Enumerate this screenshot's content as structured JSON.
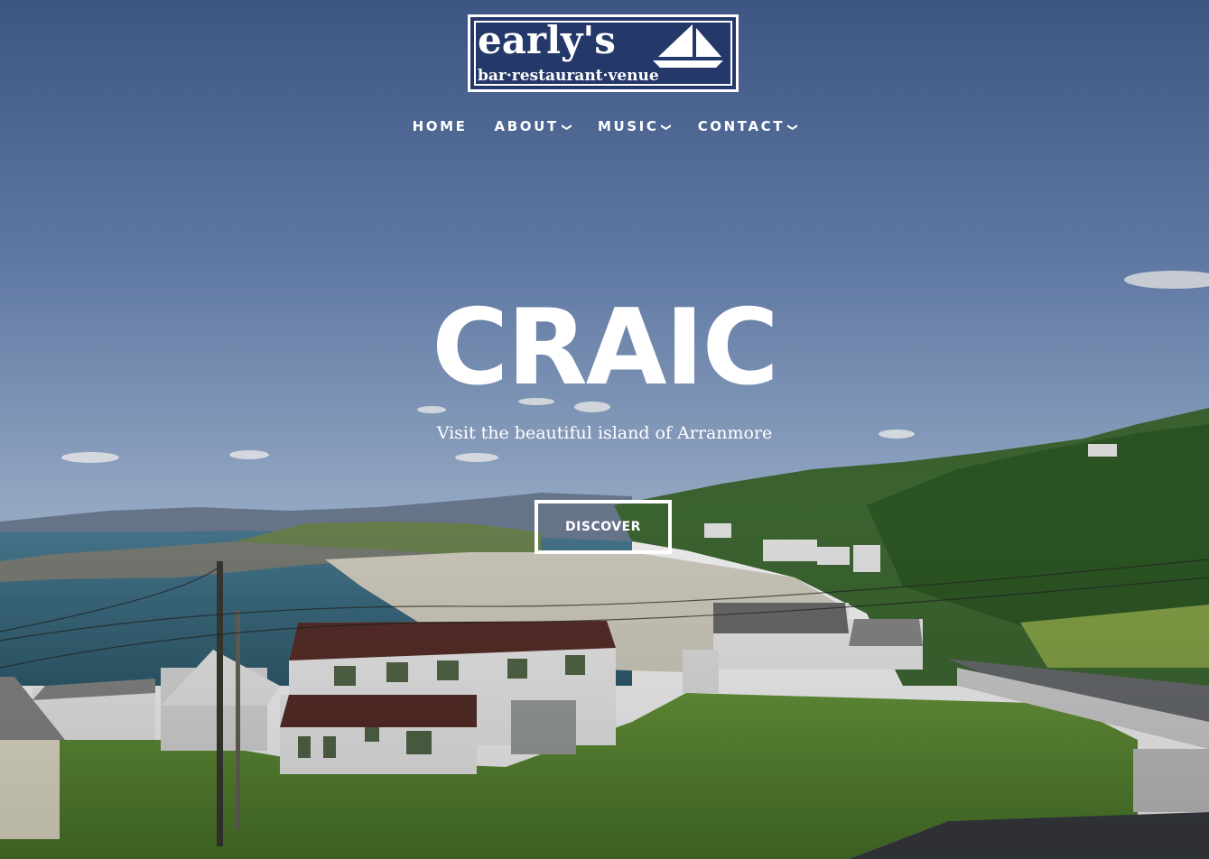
{
  "logo": {
    "brand": "early's",
    "tagline": "bar·restaurant·venue"
  },
  "nav": {
    "items": [
      {
        "label": "HOME",
        "icon": ""
      },
      {
        "label": "ABOUT",
        "icon": "chevron-down-icon"
      },
      {
        "label": "MUSIC",
        "icon": "chevron-down-icon"
      },
      {
        "label": "CONTACT",
        "icon": "chevron-down-icon"
      }
    ]
  },
  "hero": {
    "headline": "CRAIC",
    "subline": "Visit the beautiful island of Arranmore",
    "cta_label": "DISCOVER"
  },
  "colors": {
    "sky_top": "#4f6fa8",
    "sky_bottom": "#9fb4d2",
    "grass": "#5e8e36",
    "sea": "#3e6f84",
    "logo_bg": "#25386a",
    "text": "#ffffff"
  }
}
